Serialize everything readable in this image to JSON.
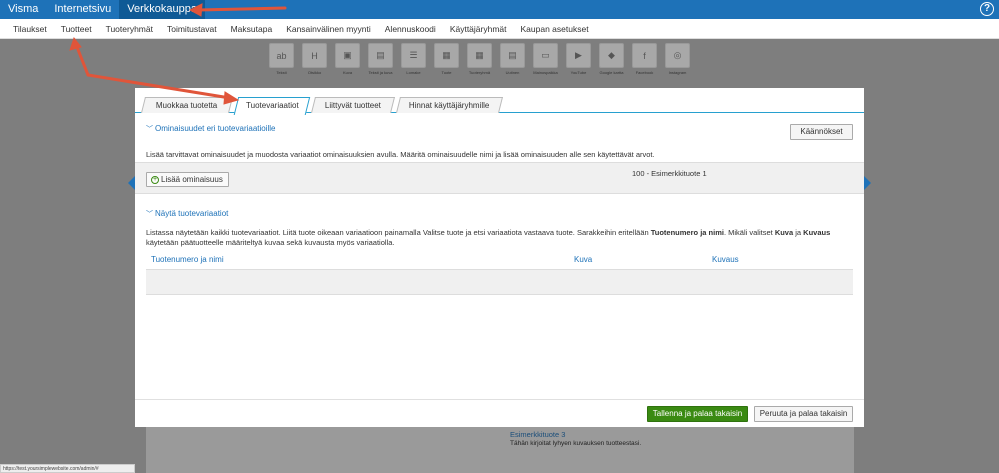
{
  "topbar": {
    "tabs": [
      "Visma",
      "Internetsivu",
      "Verkkokauppa"
    ],
    "help_icon": "?"
  },
  "subnav": {
    "items": [
      "Tilaukset",
      "Tuotteet",
      "Tuoteryhmät",
      "Toimitustavat",
      "Maksutapa",
      "Kansainvälinen myynti",
      "Alennuskoodi",
      "Käyttäjäryhmät",
      "Kaupan asetukset"
    ]
  },
  "widgets": [
    {
      "label": "Teksti",
      "icon": "text-icon",
      "glyph": "ab"
    },
    {
      "label": "Otsikko",
      "icon": "heading-icon",
      "glyph": "H"
    },
    {
      "label": "Kuva",
      "icon": "image-icon",
      "glyph": "▣"
    },
    {
      "label": "Teksti ja kuva",
      "icon": "text-image-icon",
      "glyph": "▤"
    },
    {
      "label": "Lomake",
      "icon": "form-icon",
      "glyph": "☰"
    },
    {
      "label": "Tuote",
      "icon": "product-icon",
      "glyph": "▦"
    },
    {
      "label": "Tuoteryhmä",
      "icon": "product-group-icon",
      "glyph": "▦"
    },
    {
      "label": "Uutinen",
      "icon": "news-icon",
      "glyph": "▤"
    },
    {
      "label": "Mainospaikka",
      "icon": "ad-icon",
      "glyph": "▭"
    },
    {
      "label": "YouTube",
      "icon": "youtube-icon",
      "glyph": "▶"
    },
    {
      "label": "Google kartta",
      "icon": "map-icon",
      "glyph": "◆"
    },
    {
      "label": "Facebook",
      "icon": "facebook-icon",
      "glyph": "f"
    },
    {
      "label": "Instagram",
      "icon": "instagram-icon",
      "glyph": "◎"
    }
  ],
  "modal": {
    "tabs": [
      "Muokkaa tuotetta",
      "Tuotevariaatiot",
      "Liittyvät tuotteet",
      "Hinnat käyttäjäryhmille"
    ],
    "section1_title": "Ominaisuudet eri tuotevariaatioille",
    "translations_button": "Käännökset",
    "section1_desc": "Lisää tarvittavat ominaisuudet ja muodosta variaatiot ominaisuuksien avulla. Määritä ominaisuudelle nimi ja lisää ominaisuuden alle sen käytettävät arvot.",
    "add_property_button": "Lisää ominaisuus",
    "variant_product": "100 - Esimerkkituote 1",
    "section2_title": "Näytä tuotevariaatiot",
    "section2_desc_part1": "Listassa näytetään kaikki tuotevariaatiot. Liitä tuote oikeaan variaatioon painamalla Valitse tuote ja etsi variaatiota vastaava tuote. Sarakkeihin eritellään ",
    "section2_desc_bold1": "Tuotenumero ja nimi",
    "section2_desc_part2": ". Mikäli valitset ",
    "section2_desc_bold2": "Kuva",
    "section2_desc_part3": " ja ",
    "section2_desc_bold3": "Kuvaus",
    "section2_desc_part4": " käytetään päätuotteelle määriteltyä kuvaa sekä kuvausta myös variaatiolla.",
    "table_headers": [
      "Tuotenumero ja nimi",
      "Kuva",
      "Kuvaus"
    ],
    "save_button": "Tallenna ja palaa takaisin",
    "cancel_button": "Peruuta ja palaa takaisin"
  },
  "background": {
    "product_title": "Esimerkkituote 3",
    "product_desc": "Tähän kirjoitat lyhyen kuvauksen tuotteestasi.",
    "status_url": "https://test.yoursimplewebsite.com/admin/#"
  },
  "colors": {
    "topbar": "#1e72b8",
    "accent": "#27a0cf",
    "primary_button": "#3a8a12",
    "arrow": "#e0553a"
  }
}
